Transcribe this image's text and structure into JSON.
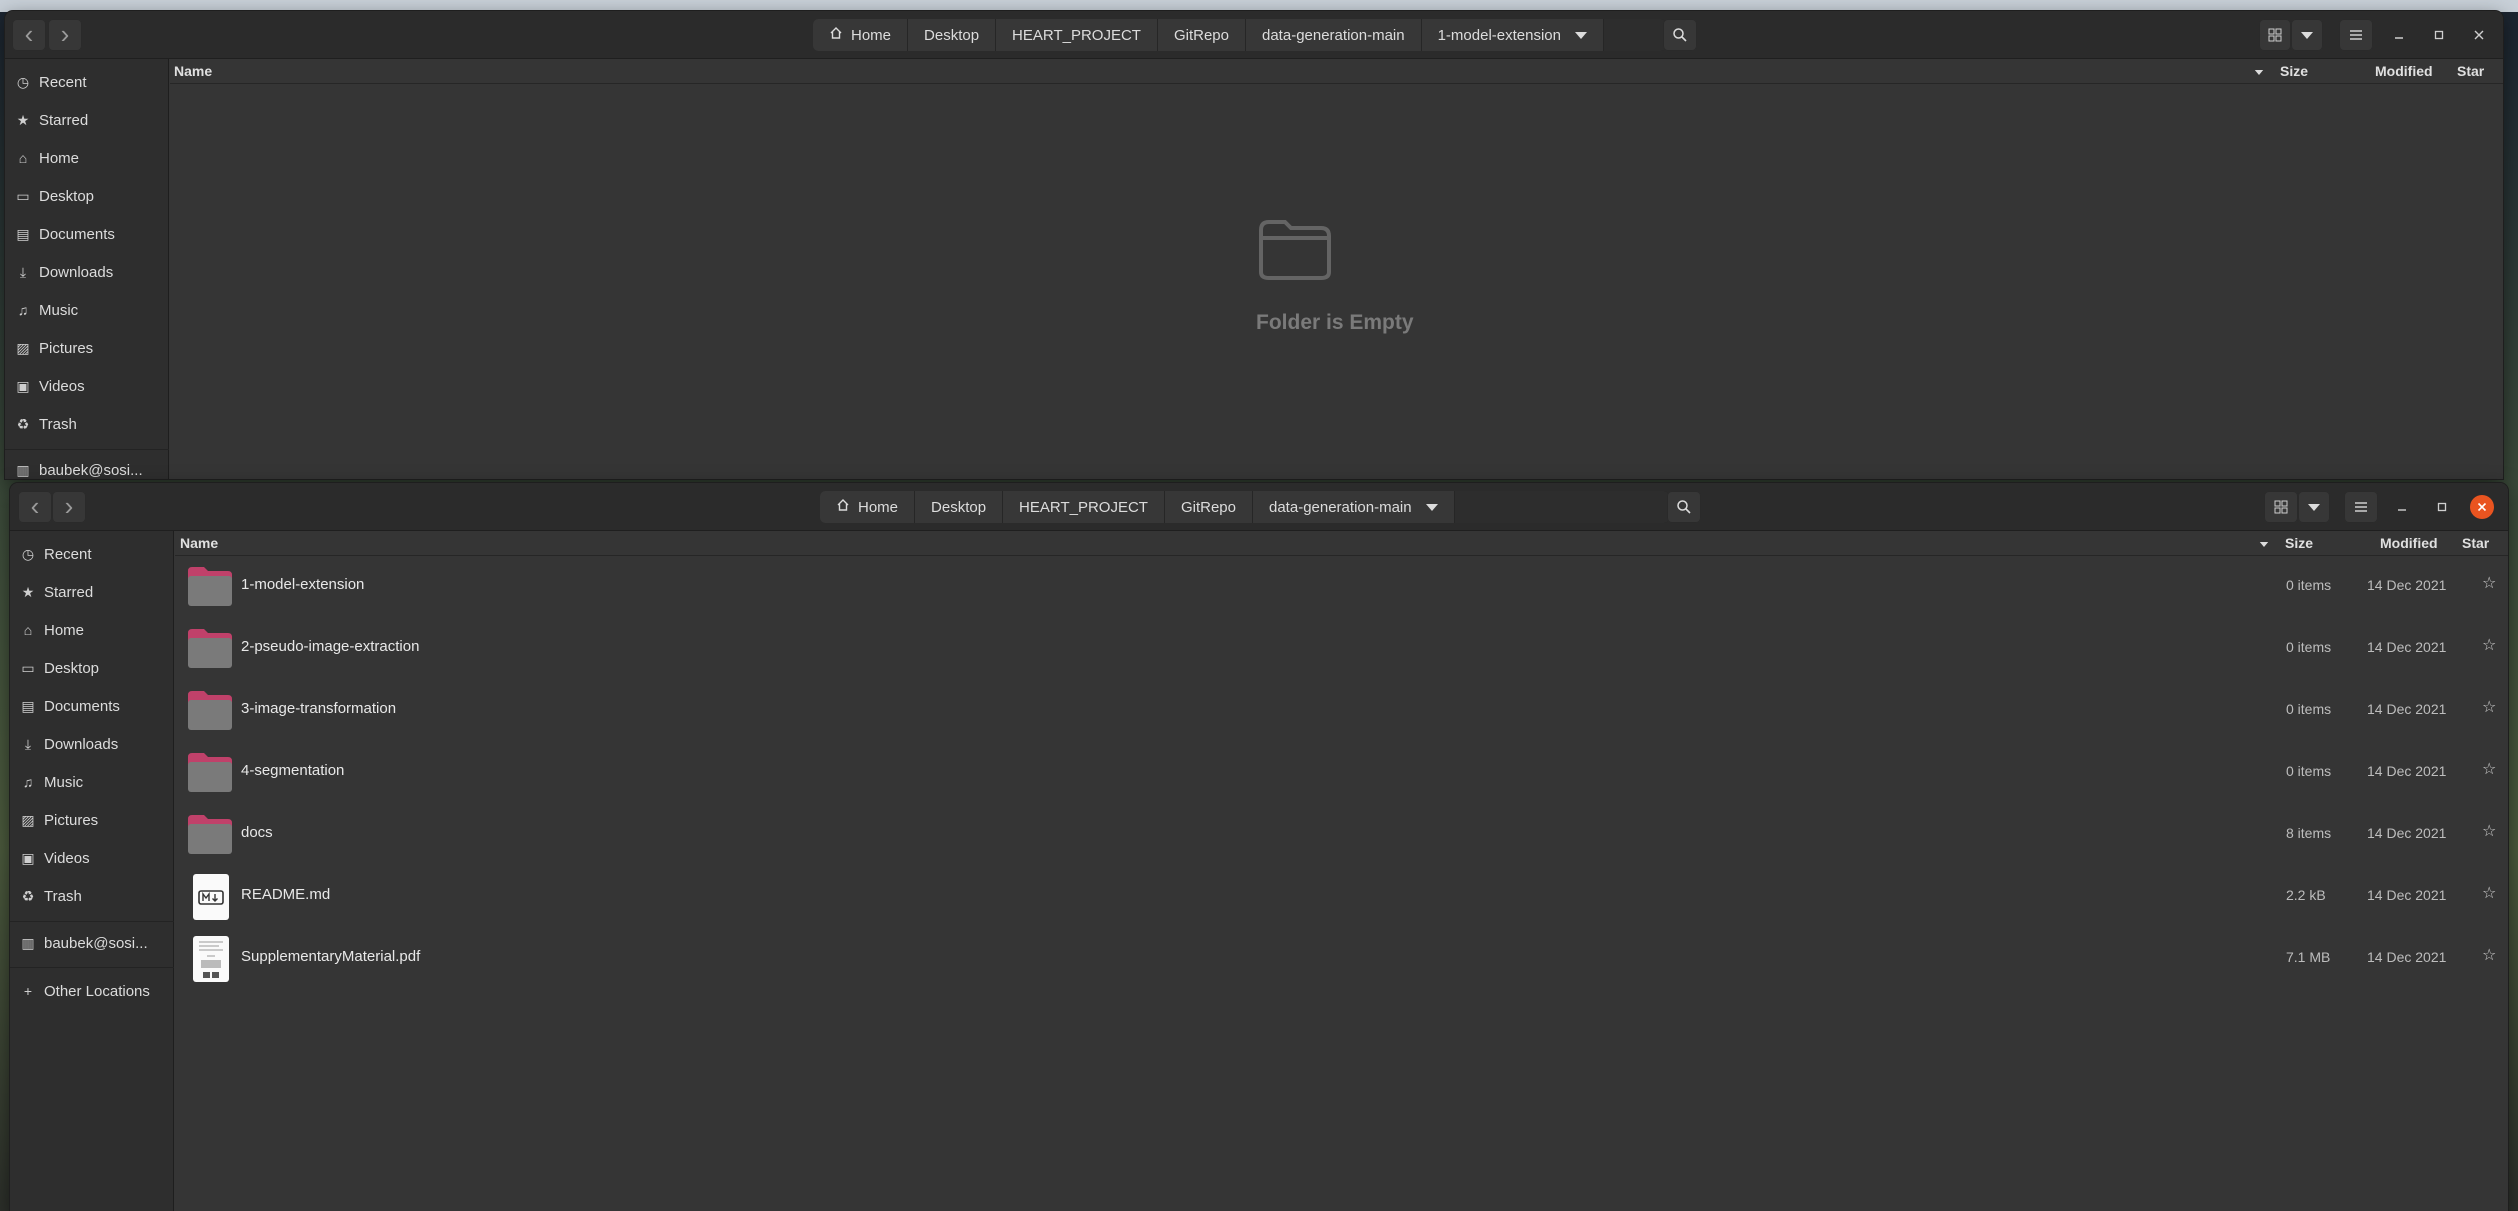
{
  "colors": {
    "accent_close": "#e95420",
    "folder_tab": "#c0416a"
  },
  "windows": {
    "back": {
      "pathbar": [
        "Home",
        "Desktop",
        "HEART_PROJECT",
        "GitRepo",
        "data-generation-main",
        "1-model-extension"
      ],
      "columns": {
        "name": "Name",
        "size": "Size",
        "modified": "Modified",
        "star": "Star"
      },
      "empty_message": "Folder is Empty",
      "sidebar": {
        "items": [
          "Recent",
          "Starred",
          "Home",
          "Desktop",
          "Documents",
          "Downloads",
          "Music",
          "Pictures",
          "Videos",
          "Trash"
        ],
        "device": "baubek@sosi..."
      }
    },
    "front": {
      "pathbar": [
        "Home",
        "Desktop",
        "HEART_PROJECT",
        "GitRepo",
        "data-generation-main"
      ],
      "columns": {
        "name": "Name",
        "size": "Size",
        "modified": "Modified",
        "star": "Star"
      },
      "sidebar": {
        "items": [
          "Recent",
          "Starred",
          "Home",
          "Desktop",
          "Documents",
          "Downloads",
          "Music",
          "Pictures",
          "Videos",
          "Trash"
        ],
        "device": "baubek@sosi...",
        "other": "Other Locations"
      },
      "files": [
        {
          "name": "1-model-extension",
          "size": "0 items",
          "modified": "14 Dec 2021",
          "icon": "folder-icon"
        },
        {
          "name": "2-pseudo-image-extraction",
          "size": "0 items",
          "modified": "14 Dec 2021",
          "icon": "folder-icon"
        },
        {
          "name": "3-image-transformation",
          "size": "0 items",
          "modified": "14 Dec 2021",
          "icon": "folder-icon"
        },
        {
          "name": "4-segmentation",
          "size": "0 items",
          "modified": "14 Dec 2021",
          "icon": "folder-icon"
        },
        {
          "name": "docs",
          "size": "8 items",
          "modified": "14 Dec 2021",
          "icon": "folder-icon"
        },
        {
          "name": "README.md",
          "size": "2.2 kB",
          "modified": "14 Dec 2021",
          "icon": "markdown-file-icon"
        },
        {
          "name": "SupplementaryMaterial.pdf",
          "size": "7.1 MB",
          "modified": "14 Dec 2021",
          "icon": "pdf-file-icon"
        }
      ]
    }
  }
}
